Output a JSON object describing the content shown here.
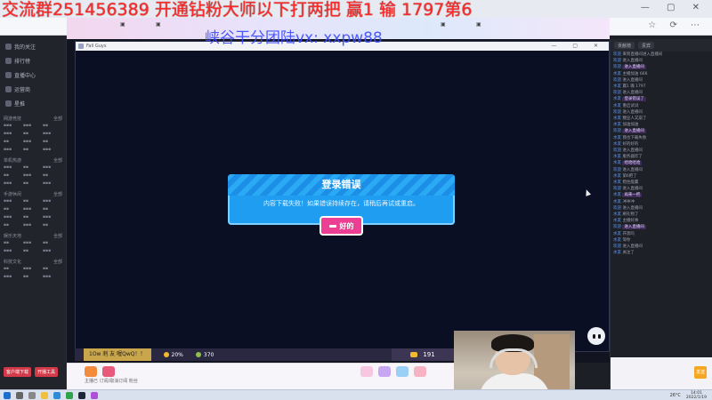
{
  "overlay": {
    "top_text": "交流群251456389 开通钻粉大师以下打两把 赢1 输 1797第6",
    "watermark": "峡谷干分团陆vx: xxpw88"
  },
  "game": {
    "window_title": "Fall Guys",
    "dialog": {
      "title": "登录错误",
      "message": "内容下载失败！如果错误持续存在，请稍后再试或重启。",
      "ok_label": "好的"
    },
    "hud": {
      "name_tag": "1Ow 刺 友 喔QwQ！！",
      "percent": "20%",
      "kudos": "370",
      "crowns": "191"
    }
  },
  "left_nav": {
    "items": [
      "我的关注",
      "排行榜",
      "直播中心",
      "运营商",
      "星推"
    ],
    "sections": [
      {
        "title": "网游竞技",
        "more": "全部"
      },
      {
        "title": "单机热游",
        "more": "全部"
      },
      {
        "title": "手游休闲",
        "more": "全部"
      },
      {
        "title": "娱乐天地",
        "more": "全部"
      },
      {
        "title": "科技文化",
        "more": "全部"
      }
    ],
    "footer": [
      "客户端下载",
      "开播工具"
    ]
  },
  "right_panel": {
    "tabs": [
      "贡献榜",
      "贵宾"
    ],
    "chat": [
      {
        "user": "欢迎",
        "text": "来到直播间进入直播间"
      },
      {
        "user": "欢迎",
        "text": "进入直播间"
      },
      {
        "user": "欢迎",
        "text": "进入直播间"
      },
      {
        "user": "水友",
        "text": "主播加油 666"
      },
      {
        "user": "欢迎",
        "text": "进入直播间"
      },
      {
        "user": "水友",
        "text": "赢1 输 1797"
      },
      {
        "user": "欢迎",
        "text": "进入直播间"
      },
      {
        "user": "水友",
        "text": "登录错误了"
      },
      {
        "user": "水友",
        "text": "重启试试"
      },
      {
        "user": "欢迎",
        "text": "进入直播间"
      },
      {
        "user": "水友",
        "text": "糖豆人又崩了"
      },
      {
        "user": "水友",
        "text": "加油加油"
      },
      {
        "user": "欢迎",
        "text": "进入直播间"
      },
      {
        "user": "水友",
        "text": "我也下载失败"
      },
      {
        "user": "水友",
        "text": "好的好的"
      },
      {
        "user": "欢迎",
        "text": "进入直播间"
      },
      {
        "user": "水友",
        "text": "服务器炸了"
      },
      {
        "user": "水友",
        "text": "哈哈哈哈"
      },
      {
        "user": "欢迎",
        "text": "进入直播间"
      },
      {
        "user": "水友",
        "text": "第6把了"
      },
      {
        "user": "水友",
        "text": "稳住能赢"
      },
      {
        "user": "欢迎",
        "text": "进入直播间"
      },
      {
        "user": "水友",
        "text": "再来一把"
      },
      {
        "user": "水友",
        "text": "冲冲冲"
      },
      {
        "user": "欢迎",
        "text": "进入直播间"
      },
      {
        "user": "水友",
        "text": "刷礼物了"
      },
      {
        "user": "水友",
        "text": "主播好帅"
      },
      {
        "user": "欢迎",
        "text": "进入直播间"
      },
      {
        "user": "水友",
        "text": "开黑吗"
      },
      {
        "user": "水友",
        "text": "等你"
      },
      {
        "user": "欢迎",
        "text": "进入直播间"
      },
      {
        "user": "水友",
        "text": "关注了"
      }
    ],
    "send": "发送"
  },
  "bottom": {
    "text": "主播已 订阅/取消订阅 粉丝"
  },
  "taskbar": {
    "temp": "26°C",
    "time": "14:01",
    "date": "2022/1/19"
  }
}
